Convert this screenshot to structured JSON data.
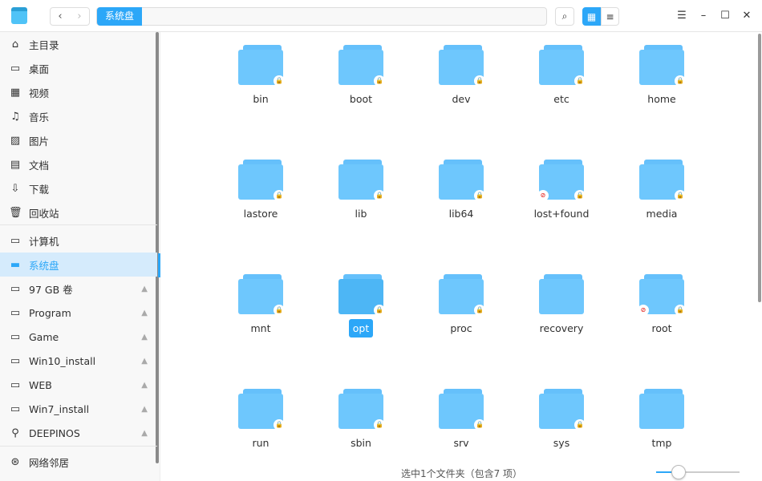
{
  "window": {
    "nav_back": "‹",
    "nav_forward": "›",
    "breadcrumb": "系统盘",
    "search_icon": "⌕",
    "view_icon_grid": "▦",
    "view_icon_list": "≡",
    "menu": "☰",
    "minimize": "–",
    "maximize": "☐",
    "close": "✕"
  },
  "sidebar": {
    "items": [
      {
        "label": "主目录",
        "icon": "⌂"
      },
      {
        "label": "桌面",
        "icon": "▭"
      },
      {
        "label": "视频",
        "icon": "▦"
      },
      {
        "label": "音乐",
        "icon": "♫"
      },
      {
        "label": "图片",
        "icon": "▨"
      },
      {
        "label": "文档",
        "icon": "▤"
      },
      {
        "label": "下载",
        "icon": "⇩"
      },
      {
        "label": "回收站",
        "icon": "🗑"
      },
      {
        "label": "计算机",
        "icon": "▭"
      },
      {
        "label": "系统盘",
        "icon": "▬",
        "selected": true
      },
      {
        "label": "97 GB 卷",
        "icon": "▭",
        "eject": true
      },
      {
        "label": "Program",
        "icon": "▭",
        "eject": true
      },
      {
        "label": "Game",
        "icon": "▭",
        "eject": true
      },
      {
        "label": "Win10_install",
        "icon": "▭",
        "eject": true
      },
      {
        "label": "WEB",
        "icon": "▭",
        "eject": true
      },
      {
        "label": "Win7_install",
        "icon": "▭",
        "eject": true
      },
      {
        "label": "DEEPINOS",
        "icon": "⚲",
        "eject": true
      },
      {
        "label": "网络邻居",
        "icon": "⊛"
      }
    ]
  },
  "folders": [
    {
      "name": "bin",
      "lock": true
    },
    {
      "name": "boot",
      "lock": true
    },
    {
      "name": "dev",
      "lock": true
    },
    {
      "name": "etc",
      "lock": true
    },
    {
      "name": "home",
      "lock": true
    },
    {
      "name": "lastore",
      "lock": true
    },
    {
      "name": "lib",
      "lock": true
    },
    {
      "name": "lib64",
      "lock": true
    },
    {
      "name": "lost+found",
      "lock": true,
      "no_access": true
    },
    {
      "name": "media",
      "lock": true
    },
    {
      "name": "mnt",
      "lock": true
    },
    {
      "name": "opt",
      "lock": true,
      "selected": true
    },
    {
      "name": "proc",
      "lock": true
    },
    {
      "name": "recovery",
      "lock": false
    },
    {
      "name": "root",
      "lock": true,
      "no_access": true
    },
    {
      "name": "run",
      "lock": true
    },
    {
      "name": "sbin",
      "lock": true
    },
    {
      "name": "srv",
      "lock": true
    },
    {
      "name": "sys",
      "lock": true
    },
    {
      "name": "tmp",
      "lock": false
    }
  ],
  "status": {
    "text": "选中1个文件夹（包含7 项）",
    "icon_size_level": 0.27
  },
  "colors": {
    "accent": "#2ca7f8",
    "folder": "#6ec7fd",
    "lock": "#f5a623"
  }
}
